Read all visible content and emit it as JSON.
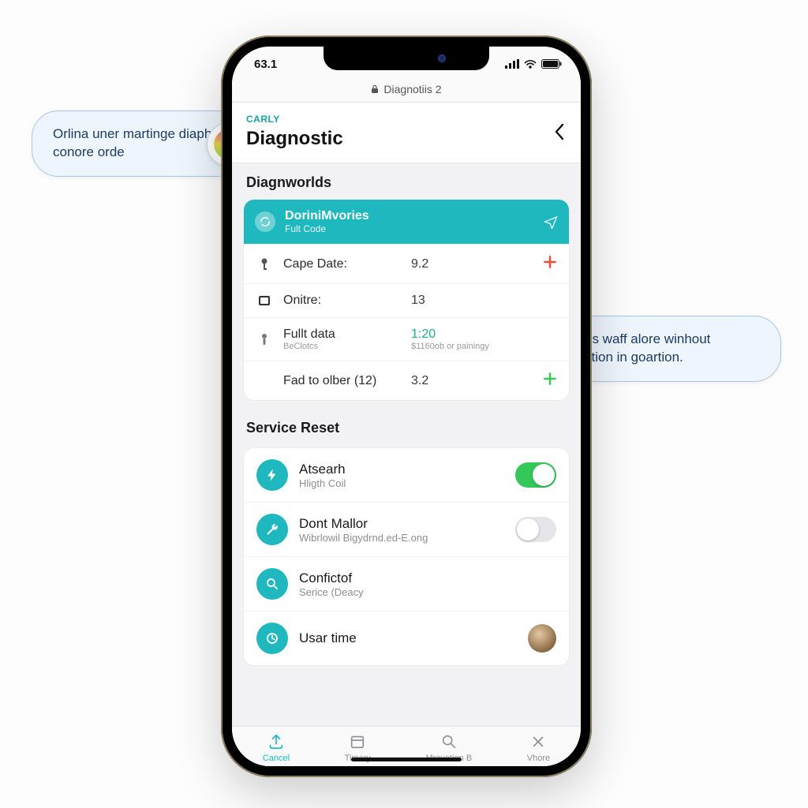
{
  "statusbar": {
    "time": "63.1"
  },
  "navbar": {
    "title": "Diagnotiis 2"
  },
  "header": {
    "brand": "CARLY",
    "title": "Diagnostic"
  },
  "diag": {
    "section_title": "Diagnworlds",
    "card_title": "DoriniMvories",
    "card_sub": "Fult Code",
    "rows": [
      {
        "label": "Cape Date:",
        "value": "9.2",
        "sub": "",
        "action": "plus-red"
      },
      {
        "label": "Onitre:",
        "value": "13",
        "sub": "",
        "action": ""
      },
      {
        "label": "Fullt data",
        "value": "1:20",
        "sub": "BeClotcs",
        "extra": "$1160ob or painingy",
        "action": ""
      },
      {
        "label": "Fad to olber (12)",
        "value": "3.2",
        "sub": "",
        "action": "plus-green"
      }
    ]
  },
  "service": {
    "title": "Service Reset",
    "items": [
      {
        "title": "Atsearh",
        "sub": "Hligth Coil",
        "toggle": "on"
      },
      {
        "title": "Dont Mallor",
        "sub": "Wibrlowil Bigydrnd.ed-E.ong",
        "toggle": "off"
      },
      {
        "title": "Confictof",
        "sub": "Serice (Deacy",
        "toggle": null
      },
      {
        "title": "Usar time",
        "sub": "",
        "toggle": null,
        "avatar": true
      }
    ]
  },
  "tabs": [
    {
      "label": "Cancel"
    },
    {
      "label": "Timery"
    },
    {
      "label": "Mrovation B"
    },
    {
      "label": "Vhore"
    }
  ],
  "callouts": {
    "left": "Orlina uner martinge diaphot conore orde",
    "right": "Dalh is waff alore winhout worration in goartion."
  }
}
